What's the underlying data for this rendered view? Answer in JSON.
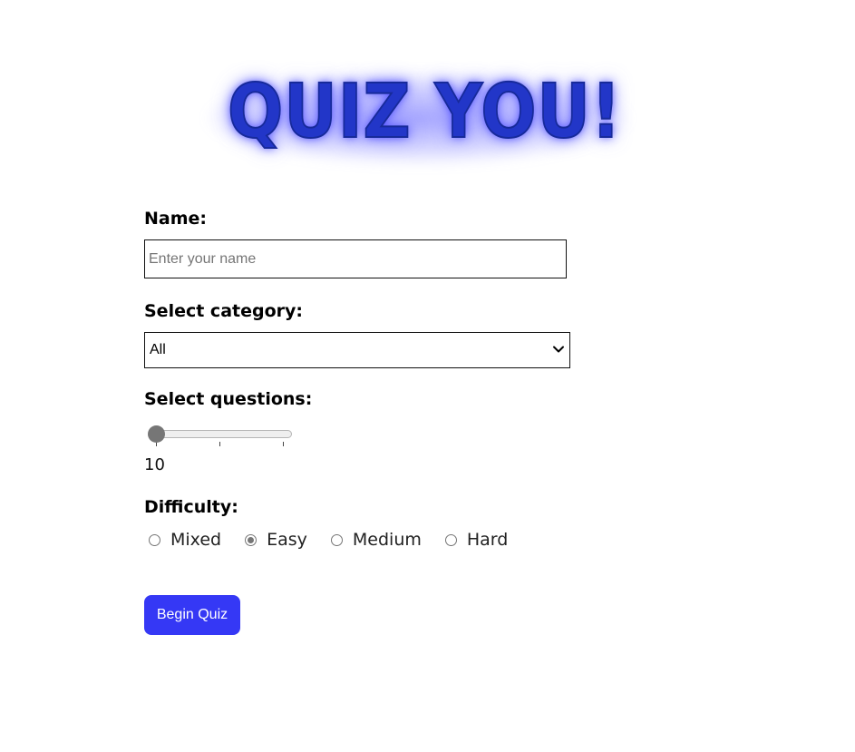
{
  "logo": {
    "text": "QUIZ YOU!",
    "color": "#2236c8",
    "glow_color": "#5a5aff"
  },
  "form": {
    "name": {
      "label": "Name:",
      "placeholder": "Enter your name",
      "value": ""
    },
    "category": {
      "label": "Select category:",
      "selected": "All",
      "icon": "chevron-down-icon"
    },
    "questions": {
      "label": "Select questions:",
      "value": "10",
      "slider_position": 0,
      "tick_count": 3
    },
    "difficulty": {
      "label": "Difficulty:",
      "options": [
        {
          "label": "Mixed",
          "checked": false
        },
        {
          "label": "Easy",
          "checked": true
        },
        {
          "label": "Medium",
          "checked": false
        },
        {
          "label": "Hard",
          "checked": false
        }
      ]
    },
    "submit": {
      "label": "Begin Quiz",
      "color": "#3538f5"
    }
  }
}
